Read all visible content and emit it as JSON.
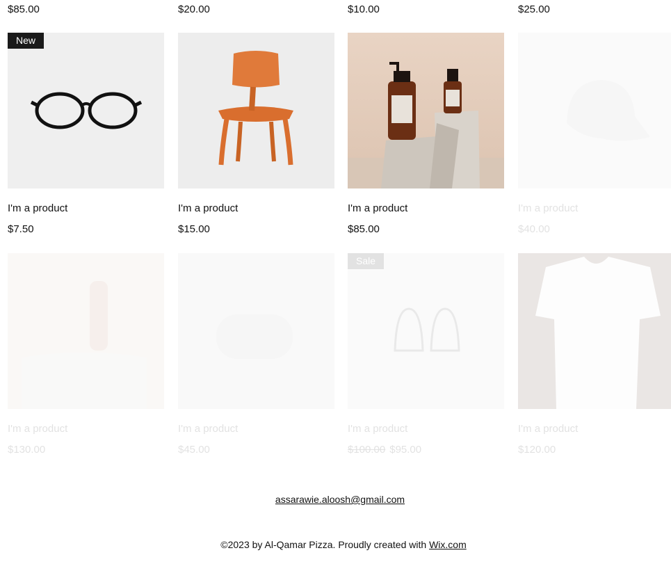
{
  "top_prices": [
    "$85.00",
    "$20.00",
    "$10.00",
    "$25.00"
  ],
  "row1": [
    {
      "name": "I'm a product",
      "price": "$7.50",
      "ribbon": "New",
      "icon": "glasses-icon"
    },
    {
      "name": "I'm a product",
      "price": "$15.00",
      "ribbon": "",
      "icon": "chair-icon"
    },
    {
      "name": "I'm a product",
      "price": "$85.00",
      "ribbon": "",
      "icon": "bottles-icon"
    },
    {
      "name": "I'm a product",
      "price": "$40.00",
      "ribbon": "",
      "icon": "cap-icon"
    }
  ],
  "row2": [
    {
      "name": "I'm a product",
      "price": "$130.00",
      "ribbon": "",
      "icon": "bottle-icon"
    },
    {
      "name": "I'm a product",
      "price": "$45.00",
      "ribbon": "",
      "icon": "soap-icon"
    },
    {
      "name": "I'm a product",
      "old_price": "$100.00",
      "price": "$95.00",
      "ribbon": "Sale",
      "icon": "earrings-icon"
    },
    {
      "name": "I'm a product",
      "price": "$120.00",
      "ribbon": "",
      "icon": "tshirt-icon"
    }
  ],
  "footer": {
    "email": "assarawie.aloosh@gmail.com",
    "copyright_prefix": "©2023 by Al-Qamar Pizza. Proudly created with ",
    "copyright_link": "Wix.com"
  },
  "colors": {
    "ribbon_bg": "#1a1a1a",
    "chair": "#e07a3a",
    "bottle_brown": "#6b2f14",
    "photo_bg": "#e9d7c8"
  }
}
